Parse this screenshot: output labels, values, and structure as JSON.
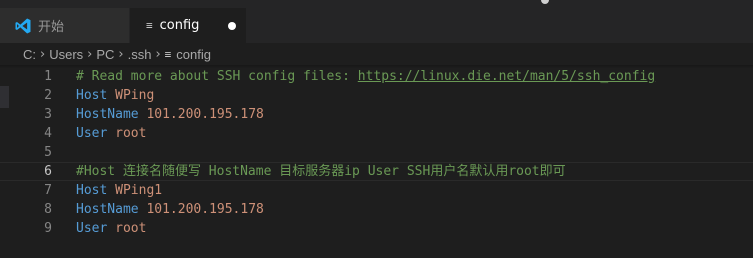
{
  "tabs": [
    {
      "label": "开始",
      "icon": "vscode-icon",
      "active": false
    },
    {
      "label": "config",
      "icon": "file-lines-icon",
      "active": true,
      "dirty": true
    }
  ],
  "breadcrumb": {
    "parts": [
      "C:",
      "Users",
      "PC",
      ".ssh"
    ],
    "file": "config",
    "separator": "›"
  },
  "editor": {
    "current_line": 6,
    "lines": [
      {
        "num": "1",
        "segments": [
          {
            "text": "# Read more about SSH config files: ",
            "kind": "comment"
          },
          {
            "text": "https://linux.die.net/man/5/ssh_config",
            "kind": "link"
          }
        ]
      },
      {
        "num": "2",
        "segments": [
          {
            "text": "Host ",
            "kind": "kw"
          },
          {
            "text": "WPing",
            "kind": "val"
          }
        ]
      },
      {
        "num": "3",
        "segments": [
          {
            "text": "HostName ",
            "kind": "kw"
          },
          {
            "text": "101.200.195.178",
            "kind": "val"
          }
        ]
      },
      {
        "num": "4",
        "segments": [
          {
            "text": "User ",
            "kind": "kw"
          },
          {
            "text": "root",
            "kind": "val"
          }
        ]
      },
      {
        "num": "5",
        "segments": []
      },
      {
        "num": "6",
        "segments": [
          {
            "text": "#Host 连接名随便写 HostName 目标服务器ip User SSH用户名默认用root即可",
            "kind": "comment"
          }
        ]
      },
      {
        "num": "7",
        "segments": [
          {
            "text": "Host ",
            "kind": "kw"
          },
          {
            "text": "WPing1",
            "kind": "val"
          }
        ]
      },
      {
        "num": "8",
        "segments": [
          {
            "text": "HostName ",
            "kind": "kw"
          },
          {
            "text": "101.200.195.178",
            "kind": "val"
          }
        ]
      },
      {
        "num": "9",
        "segments": [
          {
            "text": "User ",
            "kind": "kw"
          },
          {
            "text": "root",
            "kind": "val"
          }
        ]
      }
    ]
  },
  "colors": {
    "background": "#1e1e1e",
    "comment": "#6a9955",
    "keyword": "#569cd6",
    "string": "#ce9178",
    "line_number": "#858585",
    "vscode_blue": "#23a9f2"
  }
}
